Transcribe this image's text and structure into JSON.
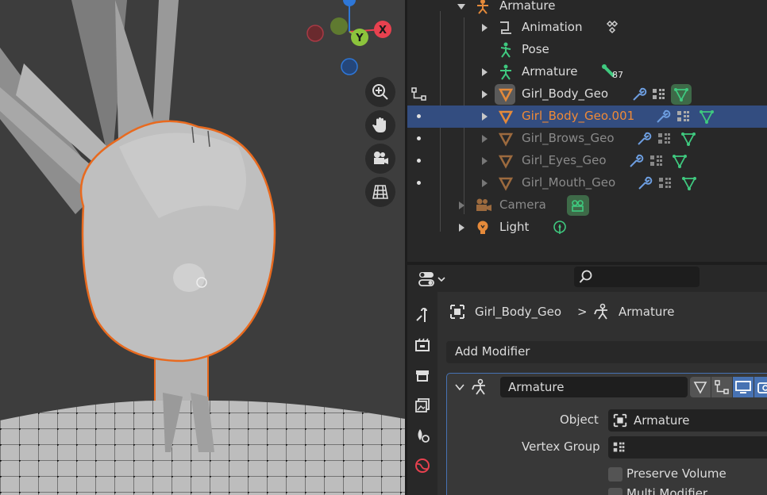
{
  "viewport": {
    "nav_buttons": [
      "zoom-icon",
      "hand-pan-icon",
      "camera-view-icon",
      "grid-ortho-icon"
    ],
    "gizmo": {
      "x_label": "X",
      "y_label": "Y"
    }
  },
  "outliner": {
    "rows": [
      {
        "label": "Armature"
      },
      {
        "label": "Animation"
      },
      {
        "label": "Pose"
      },
      {
        "label": "Armature",
        "badge": "87"
      },
      {
        "label": "Girl_Body_Geo"
      },
      {
        "label": "Girl_Body_Geo.001"
      },
      {
        "label": "Girl_Brows_Geo"
      },
      {
        "label": "Girl_Eyes_Geo"
      },
      {
        "label": "Girl_Mouth_Geo"
      },
      {
        "label": "Camera"
      },
      {
        "label": "Light"
      }
    ]
  },
  "properties": {
    "search_placeholder": "",
    "breadcrumb": {
      "object": "Girl_Body_Geo",
      "separator": ">",
      "modifier": "Armature"
    },
    "add_modifier_label": "Add Modifier",
    "modifier": {
      "name": "Armature",
      "object_label": "Object",
      "object_value": "Armature",
      "vertex_group_label": "Vertex Group",
      "vertex_group_value": "",
      "preserve_volume_label": "Preserve Volume",
      "multi_modifier_label": "Multi Modifier"
    }
  },
  "colors": {
    "selected_row": "#334d80",
    "selection_orange": "#f08a36",
    "mesh_icon": "#e58a3a",
    "modifier_blue": "#6d9ee0",
    "green_icon": "#3fc97f"
  }
}
